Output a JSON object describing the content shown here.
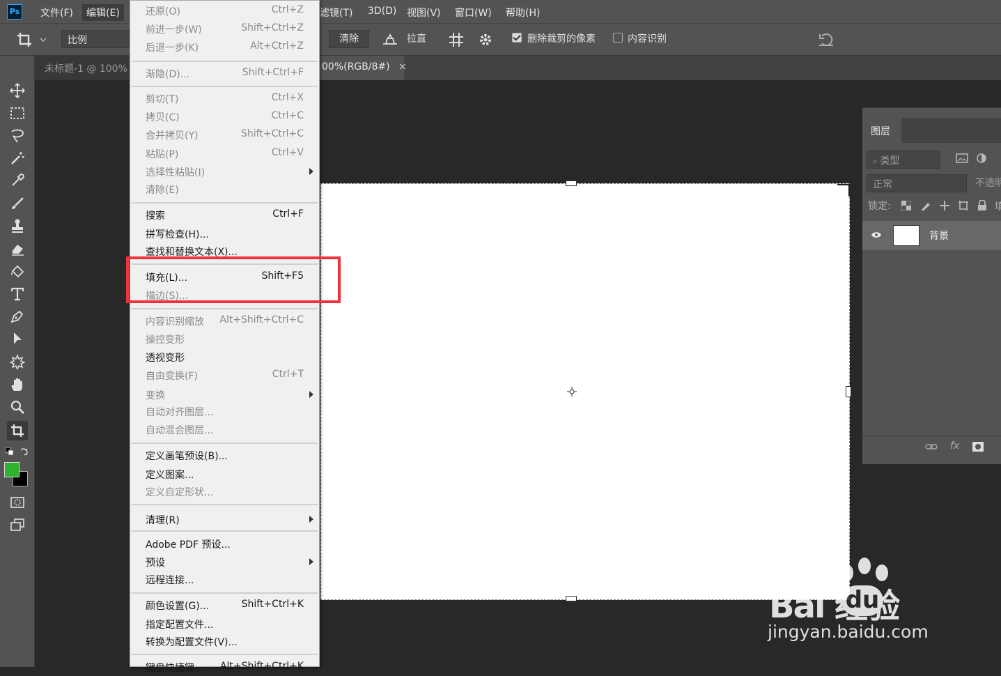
{
  "menubar": {
    "logo": "Ps",
    "items": [
      "文件(F)",
      "编辑(E)",
      "滤镜(T)",
      "3D(D)",
      "视图(V)",
      "窗口(W)",
      "帮助(H)"
    ]
  },
  "options_bar": {
    "ratio": "比例",
    "clear": "清除",
    "straighten": "拉直",
    "delete_cropped": "删除裁剪的像素",
    "content_aware": "内容识别"
  },
  "tabs": {
    "doc1": "未标题-1 @ 100%",
    "doc2": "00%(RGB/8#)",
    "close": "×"
  },
  "edit_menu": [
    {
      "label": "还原(O)",
      "shortcut": "Ctrl+Z",
      "state": "disabled"
    },
    {
      "label": "前进一步(W)",
      "shortcut": "Shift+Ctrl+Z",
      "state": "disabled"
    },
    {
      "label": "后退一步(K)",
      "shortcut": "Alt+Ctrl+Z",
      "state": "disabled"
    },
    {
      "label": "渐隐(D)...",
      "shortcut": "Shift+Ctrl+F",
      "state": "disabled"
    },
    {
      "label": "剪切(T)",
      "shortcut": "Ctrl+X",
      "state": "disabled"
    },
    {
      "label": "拷贝(C)",
      "shortcut": "Ctrl+C",
      "state": "disabled"
    },
    {
      "label": "合并拷贝(Y)",
      "shortcut": "Shift+Ctrl+C",
      "state": "disabled"
    },
    {
      "label": "粘贴(P)",
      "shortcut": "Ctrl+V",
      "state": "disabled"
    },
    {
      "label": "选择性粘贴(I)",
      "shortcut": "",
      "state": "disabled",
      "submenu": true
    },
    {
      "label": "清除(E)",
      "shortcut": "",
      "state": "disabled"
    },
    {
      "label": "搜索",
      "shortcut": "Ctrl+F",
      "state": "enabled"
    },
    {
      "label": "拼写检查(H)...",
      "shortcut": "",
      "state": "enabled"
    },
    {
      "label": "查找和替换文本(X)...",
      "shortcut": "",
      "state": "enabled"
    },
    {
      "label": "填充(L)...",
      "shortcut": "Shift+F5",
      "state": "enabled"
    },
    {
      "label": "描边(S)...",
      "shortcut": "",
      "state": "disabled"
    },
    {
      "label": "内容识别缩放",
      "shortcut": "Alt+Shift+Ctrl+C",
      "state": "disabled"
    },
    {
      "label": "操控变形",
      "shortcut": "",
      "state": "disabled"
    },
    {
      "label": "透视变形",
      "shortcut": "",
      "state": "enabled"
    },
    {
      "label": "自由变换(F)",
      "shortcut": "Ctrl+T",
      "state": "disabled"
    },
    {
      "label": "变换",
      "shortcut": "",
      "state": "disabled",
      "submenu": true
    },
    {
      "label": "自动对齐图层...",
      "shortcut": "",
      "state": "disabled"
    },
    {
      "label": "自动混合图层...",
      "shortcut": "",
      "state": "disabled"
    },
    {
      "label": "定义画笔预设(B)...",
      "shortcut": "",
      "state": "enabled"
    },
    {
      "label": "定义图案...",
      "shortcut": "",
      "state": "enabled"
    },
    {
      "label": "定义自定形状...",
      "shortcut": "",
      "state": "disabled"
    },
    {
      "label": "清理(R)",
      "shortcut": "",
      "state": "enabled",
      "submenu": true
    },
    {
      "label": "Adobe PDF 预设...",
      "shortcut": "",
      "state": "enabled"
    },
    {
      "label": "预设",
      "shortcut": "",
      "state": "enabled",
      "submenu": true
    },
    {
      "label": "远程连接...",
      "shortcut": "",
      "state": "enabled"
    },
    {
      "label": "颜色设置(G)...",
      "shortcut": "Shift+Ctrl+K",
      "state": "enabled"
    },
    {
      "label": "指定配置文件...",
      "shortcut": "",
      "state": "enabled"
    },
    {
      "label": "转换为配置文件(V)...",
      "shortcut": "",
      "state": "enabled"
    },
    {
      "label": "键盘快捷键...",
      "shortcut": "Alt+Shift+Ctrl+K",
      "state": "enabled"
    }
  ],
  "layers_panel": {
    "tab": "图层",
    "filter_placeholder": "类型",
    "blend_mode": "正常",
    "opacity_label": "不透明",
    "lock_label": "锁定:",
    "fill_label": "填",
    "layer_name": "背景"
  },
  "colors": {
    "foreground": "#2fb02f",
    "background": "#000000",
    "highlight": "#f0333a"
  },
  "watermark": {
    "brand": "Bai 经验",
    "du": "du",
    "url": "jingyan.baidu.com"
  }
}
